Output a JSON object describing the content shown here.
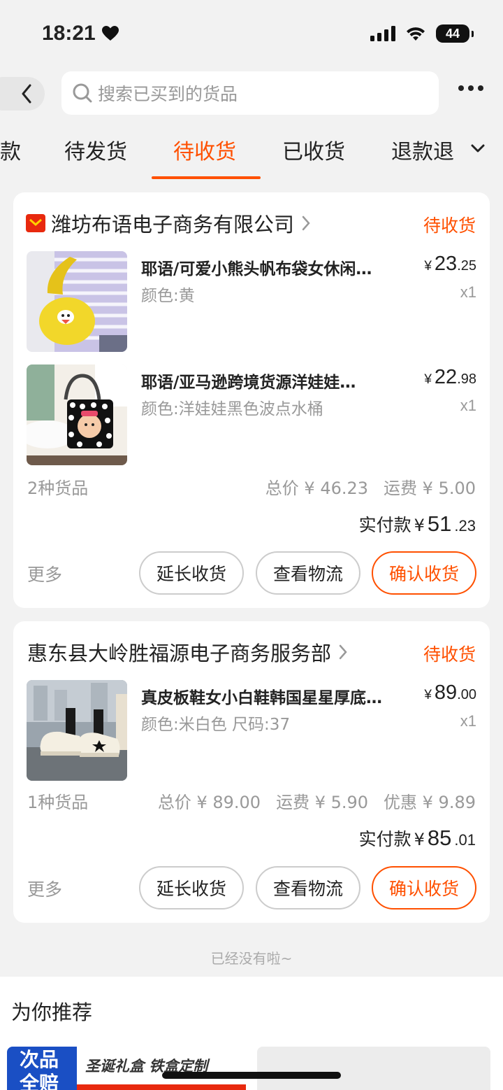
{
  "status_bar": {
    "time": "18:21",
    "battery": "44"
  },
  "search": {
    "placeholder": "搜索已买到的货品"
  },
  "tabs": [
    {
      "label": "款"
    },
    {
      "label": "待发货"
    },
    {
      "label": "待收货",
      "active": true
    },
    {
      "label": "已收货"
    },
    {
      "label": "退款退"
    }
  ],
  "orders": [
    {
      "shop_name": "潍坊布语电子商务有限公司",
      "status": "待收货",
      "items": [
        {
          "title": "耶语/可爱小熊头帆布袋女休闲…",
          "spec": "颜色:黄",
          "price_int": "23",
          "price_dec": ".25",
          "qty": "x1"
        },
        {
          "title": "耶语/亚马逊跨境货源洋娃娃…",
          "spec": "颜色:洋娃娃黑色波点水桶",
          "price_int": "22",
          "price_dec": ".98",
          "qty": "x1"
        }
      ],
      "item_count": "2种货品",
      "total": "总价 ¥ 46.23",
      "shipping": "运费 ¥ 5.00",
      "discount": "",
      "paid_label": "实付款",
      "paid_int": "51",
      "paid_dec": ".23"
    },
    {
      "shop_name": "惠东县大岭胜福源电子商务服务部",
      "status": "待收货",
      "items": [
        {
          "title": "真皮板鞋女小白鞋韩国星星厚底…",
          "spec": "颜色:米白色 尺码:37",
          "price_int": "89",
          "price_dec": ".00",
          "qty": "x1"
        }
      ],
      "item_count": "1种货品",
      "total": "总价 ¥ 89.00",
      "shipping": "运费 ¥ 5.90",
      "discount": "优惠 ¥ 9.89",
      "paid_label": "实付款",
      "paid_int": "85",
      "paid_dec": ".01"
    }
  ],
  "actions": {
    "more": "更多",
    "extend": "延长收货",
    "logistics": "查看物流",
    "confirm": "确认收货"
  },
  "currency": "¥",
  "end_text": "已经没有啦~",
  "recommend": {
    "title": "为你推荐",
    "badge": "次品全赔",
    "card_text": "圣诞礼盒 铁盒定制"
  },
  "colors": {
    "accent": "#ff5000",
    "background": "#f2f2f2",
    "shop_icon": "#e8290e"
  }
}
